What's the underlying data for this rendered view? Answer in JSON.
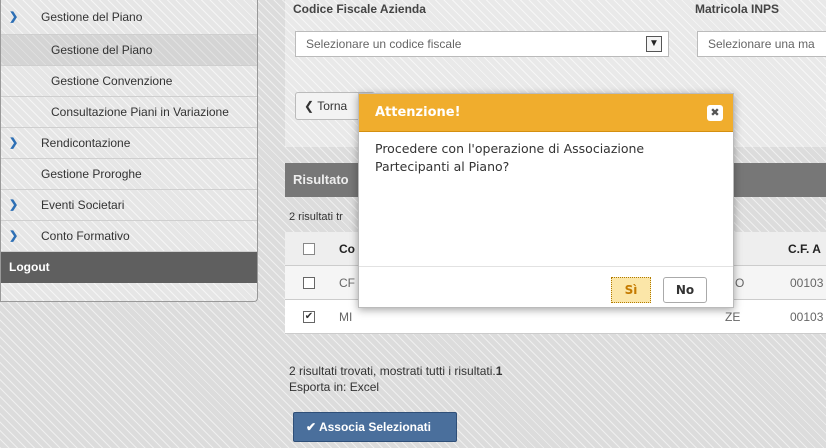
{
  "sidebar": {
    "items": [
      {
        "label": "Gestione del Piano"
      },
      {
        "label": "Gestione del Piano"
      },
      {
        "label": "Gestione Convenzione"
      },
      {
        "label": "Consultazione Piani in Variazione"
      },
      {
        "label": "Rendicontazione"
      },
      {
        "label": "Gestione Proroghe"
      },
      {
        "label": "Eventi Societari"
      },
      {
        "label": "Conto Formativo"
      }
    ],
    "logout": "Logout",
    "expanded_icon": "chevron-down-icon",
    "collapsed_icon": "chevron-right-icon"
  },
  "form": {
    "cf_label": "Codice Fiscale Azienda",
    "cf_placeholder": "Selezionare un codice fiscale",
    "matricola_label": "Matricola INPS",
    "matricola_placeholder": "Selezionare una ma",
    "back_label": "Torna"
  },
  "results": {
    "header": "Risultato",
    "count_top": "2 risultati tr",
    "columns": [
      "Co",
      "C.F. A"
    ],
    "rows": [
      {
        "checked": false,
        "col1": "CF",
        "col_mid": "O",
        "col_last": "00103"
      },
      {
        "checked": true,
        "col1": "MI",
        "col_mid": "ZE",
        "col_last": "00103"
      }
    ],
    "count_bottom_pre": "2 risultati trovati, mostrati tutti i risultati.",
    "count_bottom_num": "1",
    "export_label": "Esporta in: Excel",
    "associa_label": "Associa Selezionati"
  },
  "modal": {
    "title": "Attenzione!",
    "message": "Procedere con l'operazione di Associazione Partecipanti al Piano?",
    "yes_label": "Sì",
    "no_label": "No"
  },
  "colors": {
    "modal_header": "#f0ad2d",
    "primary_button": "#4a6f9c",
    "logout_bar": "#5f5f5f"
  }
}
